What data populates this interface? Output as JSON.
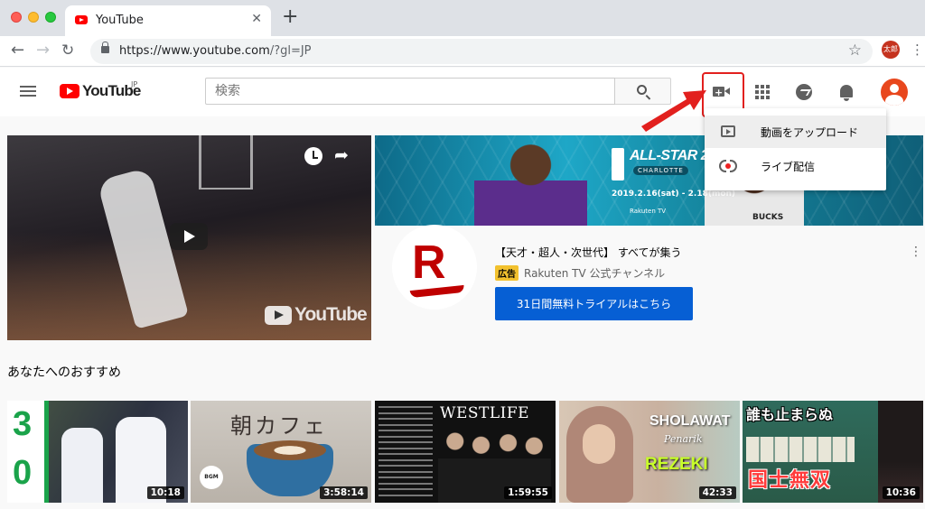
{
  "browser": {
    "tab_title": "YouTube",
    "url_host": "https://www.youtube.com",
    "url_rest": "/?gl=JP",
    "profile_label": "太郎"
  },
  "masthead": {
    "logo_text": "YouTube",
    "region": "JP",
    "search_placeholder": "検索"
  },
  "upload_menu": {
    "items": [
      {
        "label": "動画をアップロード",
        "icon": "upload-video-icon"
      },
      {
        "label": "ライブ配信",
        "icon": "live-stream-icon"
      }
    ]
  },
  "hero": {
    "watermark": "YouTube",
    "ad_banner": {
      "title": "ALL-STAR 2019",
      "city": "CHARLOTTE",
      "dates": "2019.2.16(sat) - 2.18(mon)",
      "sponsor": "Rakuten TV",
      "team": "BUCKS"
    },
    "ad": {
      "logo_letter": "R",
      "title": "【天才・超人・次世代】 すべてが集う",
      "badge": "広告",
      "channel": "Rakuten TV 公式チャンネル",
      "cta": "31日間無料トライアルはこちら"
    }
  },
  "recommended": {
    "heading": "あなたへのおすすめ",
    "videos": [
      {
        "overlay_top": "3",
        "overlay_bottom": "0",
        "duration": "10:18"
      },
      {
        "overlay": "朝カフェ",
        "badge": "BGM",
        "duration": "3:58:14"
      },
      {
        "overlay": "WESTLIFE",
        "duration": "1:59:55"
      },
      {
        "overlay_1": "SHOLAWAT",
        "overlay_2": "Penarik",
        "overlay_3": "REZEKI",
        "duration": "42:33"
      },
      {
        "overlay_1": "誰も止まらぬ",
        "overlay_2": "国士無双",
        "duration": "10:36"
      }
    ]
  },
  "colors": {
    "brand_red": "#ff0000",
    "cta_blue": "#065fd4",
    "annotation_red": "#e2201e",
    "ad_badge": "#f2c12e"
  }
}
